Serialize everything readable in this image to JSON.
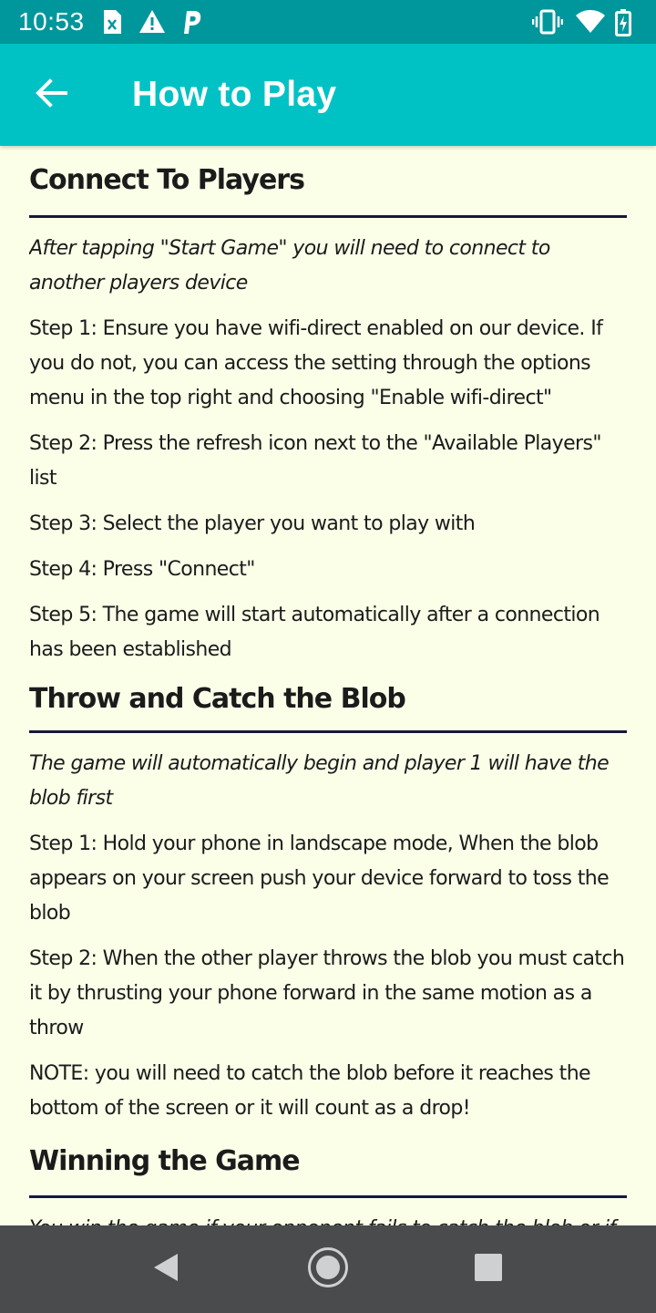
{
  "status_bar": {
    "time": "10:53",
    "notification_icons": [
      "sim-card-icon",
      "warning-icon",
      "parking-icon"
    ],
    "system_icons": [
      "vibrate-icon",
      "wifi-icon",
      "battery-icon"
    ]
  },
  "app_bar": {
    "title": "How to Play",
    "back_icon": "arrow-back-icon",
    "background": "#00c2c4"
  },
  "sections": [
    {
      "title": "Connect To Players",
      "intro": "After tapping \"Start Game\" you will need to connect to another players device",
      "steps": [
        "Step 1: Ensure you have wifi-direct enabled on our device. If you do not, you can access the setting through the options menu in the top right and choosing \"Enable wifi-direct\"",
        "Step 2: Press the refresh icon next to the \"Available Players\" list",
        "Step 3: Select the player you want to play with",
        "Step 4: Press \"Connect\"",
        "Step 5: The game will start automatically after a connection has been established"
      ]
    },
    {
      "title": "Throw and Catch the Blob",
      "intro": "The game will automatically begin and player 1 will have the blob first",
      "steps": [
        "Step 1: Hold your phone in landscape mode, When the blob appears on your screen push your device forward to toss the blob",
        "Step 2: When the other player throws the blob you must catch it by thrusting your phone forward in the same motion as a throw",
        "NOTE: you will need to catch the blob before it reaches the bottom of the screen or it will count as a drop!"
      ]
    },
    {
      "title": "Winning the Game",
      "intro": "You win the game if your opponent fails to catch the blob or if the blob explodes after your opponent catches it!",
      "steps": []
    }
  ],
  "nav_bar": {
    "buttons": [
      "back-triangle-icon",
      "home-circle-icon",
      "recents-square-icon"
    ]
  },
  "colors": {
    "status_bar": "#00979c",
    "app_bar": "#00c2c4",
    "content_background": "#fbffe8",
    "rule": "#151838",
    "nav_bar": "#494b4d"
  }
}
